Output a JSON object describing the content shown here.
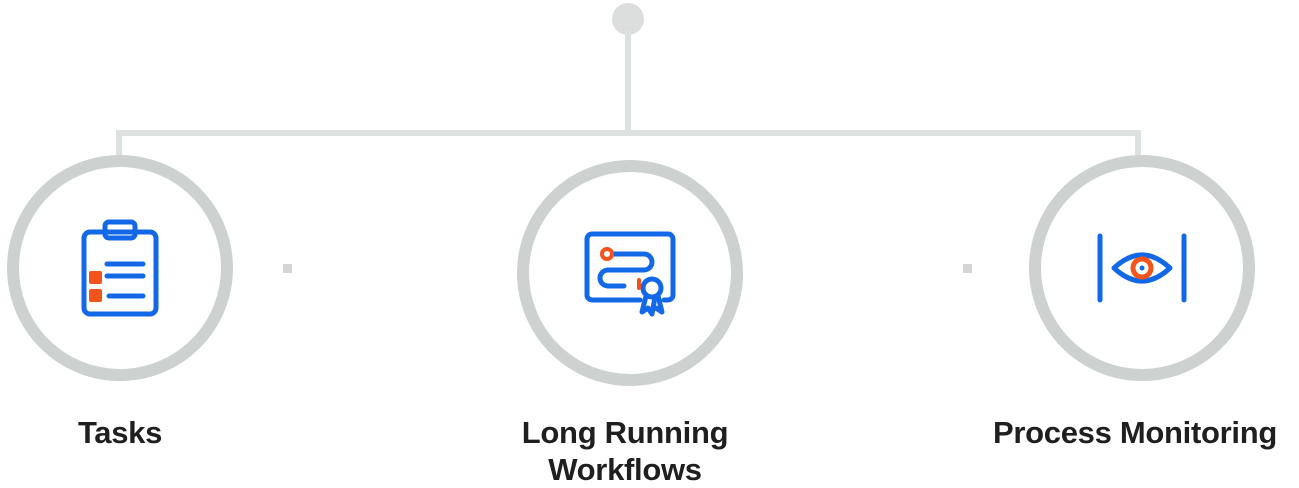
{
  "items": [
    {
      "label": "Tasks",
      "icon": "clipboard-checklist-icon"
    },
    {
      "label": "Long Running Workflows",
      "icon": "workflow-certificate-icon"
    },
    {
      "label": "Process Monitoring",
      "icon": "eye-monitoring-icon"
    }
  ],
  "colors": {
    "icon_blue": "#1368e8",
    "icon_orange": "#f2541c",
    "ring": "#cdd2d0",
    "connector": "#dde1e0",
    "text": "#1f1f1f"
  }
}
